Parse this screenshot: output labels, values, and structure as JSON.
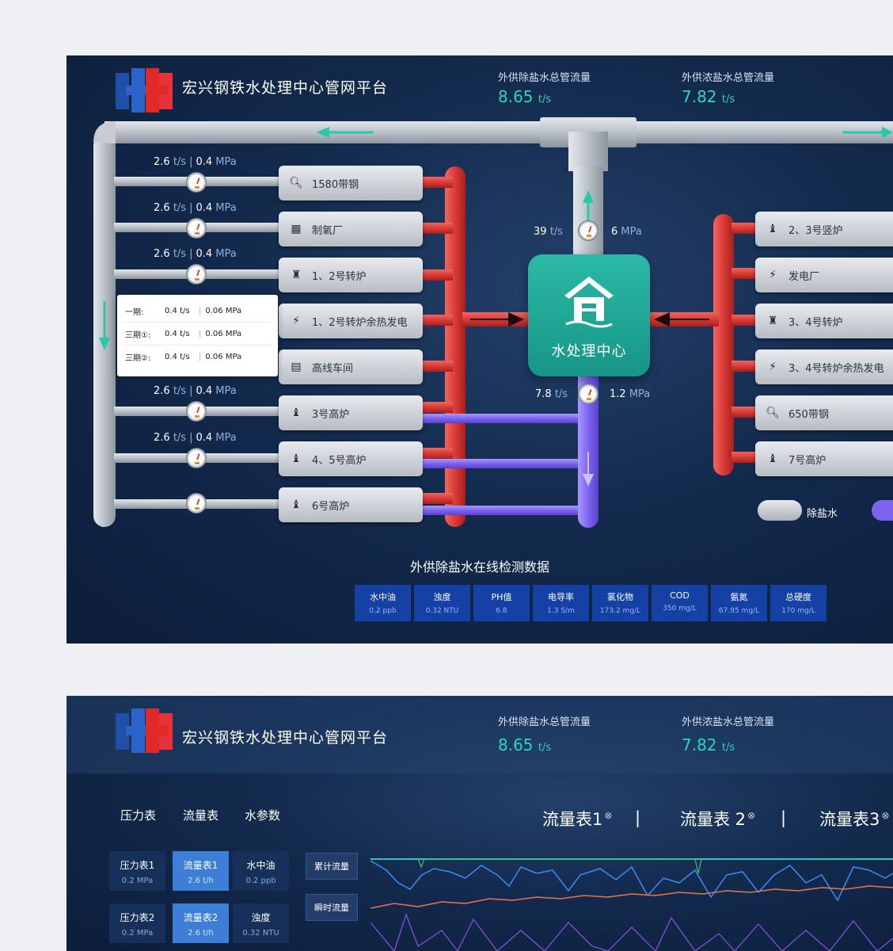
{
  "app": {
    "title": "宏兴钢铁水处理中心管网平台"
  },
  "header_metrics": [
    {
      "label": "外供除盐水总管流量",
      "value": "8.65",
      "unit": "t/s"
    },
    {
      "label": "外供浓盐水总管流量",
      "value": "7.82",
      "unit": "t/s"
    }
  ],
  "left_branches": [
    {
      "flow": "2.6",
      "flow_unit": "t/s",
      "pressure": "0.4",
      "pressure_unit": "MPa",
      "unit_name": "1580带钢",
      "icon": "gear-search-icon"
    },
    {
      "flow": "2.6",
      "flow_unit": "t/s",
      "pressure": "0.4",
      "pressure_unit": "MPa",
      "unit_name": "制氧厂",
      "icon": "oxygen-tank-icon"
    },
    {
      "flow": "2.6",
      "flow_unit": "t/s",
      "pressure": "0.4",
      "pressure_unit": "MPa",
      "unit_name": "1、2号转炉",
      "icon": "converter-icon"
    },
    {
      "unit_name": "1、2号转炉余热发电",
      "icon": "power-icon"
    },
    {
      "unit_name": "高线车间",
      "icon": "workshop-icon"
    },
    {
      "flow": "2.6",
      "flow_unit": "t/s",
      "pressure": "0.4",
      "pressure_unit": "MPa",
      "unit_name": "3号高炉",
      "icon": "furnace-icon"
    },
    {
      "flow": "2.6",
      "flow_unit": "t/s",
      "pressure": "0.4",
      "pressure_unit": "MPa",
      "unit_name": "4、5号高炉",
      "icon": "furnace-icon"
    },
    {
      "unit_name": "6号高炉",
      "icon": "furnace-icon"
    }
  ],
  "tooltip": {
    "rows": [
      {
        "name": "一期:",
        "flow": "0.4 t/s",
        "pressure": "0.06 MPa"
      },
      {
        "name": "三期①:",
        "flow": "0.4 t/s",
        "pressure": "0.06 MPa"
      },
      {
        "name": "三期②:",
        "flow": "0.4 t/s",
        "pressure": "0.06 MPa"
      }
    ]
  },
  "center": {
    "label": "水处理中心",
    "top_flow": "39",
    "top_flow_unit": "t/s",
    "top_pressure": "6",
    "top_pressure_unit": "MPa",
    "bottom_flow": "7.8",
    "bottom_flow_unit": "t/s",
    "bottom_pressure": "1.2",
    "bottom_pressure_unit": "MPa"
  },
  "right_branches": [
    {
      "unit_name": "2、3号竖炉",
      "icon": "furnace-icon"
    },
    {
      "unit_name": "发电厂",
      "icon": "power-icon"
    },
    {
      "unit_name": "3、4号转炉",
      "icon": "converter-icon"
    },
    {
      "unit_name": "3、4号转炉余热发电",
      "icon": "power-icon"
    },
    {
      "unit_name": "650带钢",
      "icon": "gear-search-icon"
    },
    {
      "unit_name": "7号高炉",
      "icon": "furnace-icon"
    }
  ],
  "legend": [
    {
      "label": "除盐水",
      "color": "#c9cfd6"
    },
    {
      "label": "",
      "color": "#7c63f0"
    }
  ],
  "params": {
    "title": "外供除盐水在线检测数据",
    "items": [
      {
        "name": "水中油",
        "value": "0.2 ppb"
      },
      {
        "name": "浊度",
        "value": "0.32 NTU"
      },
      {
        "name": "PH值",
        "value": "6.8"
      },
      {
        "name": "电导率",
        "value": "1.3 S/m"
      },
      {
        "name": "氯化物",
        "value": "173.2 mg/L"
      },
      {
        "name": "COD",
        "value": "350 mg/L"
      },
      {
        "name": "氨氮",
        "value": "67.95 mg/L"
      },
      {
        "name": "总硬度",
        "value": "170 mg/L"
      }
    ]
  },
  "colors": {
    "accent": "#27d8b8",
    "hot_pipe": "#d93a36",
    "cold_pipe": "#7c63f0",
    "gray_pipe": "#c2c8cf",
    "center": "#1fa694"
  },
  "screen2": {
    "tabs": [
      "压力表",
      "流量表",
      "水参数"
    ],
    "meter_tabs": [
      "流量表1",
      "流量表 2",
      "流量表3"
    ],
    "separator": "|",
    "close_glyph": "⊗",
    "grid": [
      [
        {
          "name": "压力表1",
          "value": "0.2 MPa",
          "active": false
        },
        {
          "name": "流量表1",
          "value": "2.6 t/h",
          "active": true
        },
        {
          "name": "水中油",
          "value": "0.2 ppb",
          "active": false
        }
      ],
      [
        {
          "name": "压力表2",
          "value": "0.2 MPa",
          "active": false
        },
        {
          "name": "流量表2",
          "value": "2.6 t/h",
          "active": true
        },
        {
          "name": "浊度",
          "value": "0.32 NTU",
          "active": false
        }
      ]
    ],
    "side_buttons": [
      "累计流量",
      "瞬时流量"
    ]
  }
}
